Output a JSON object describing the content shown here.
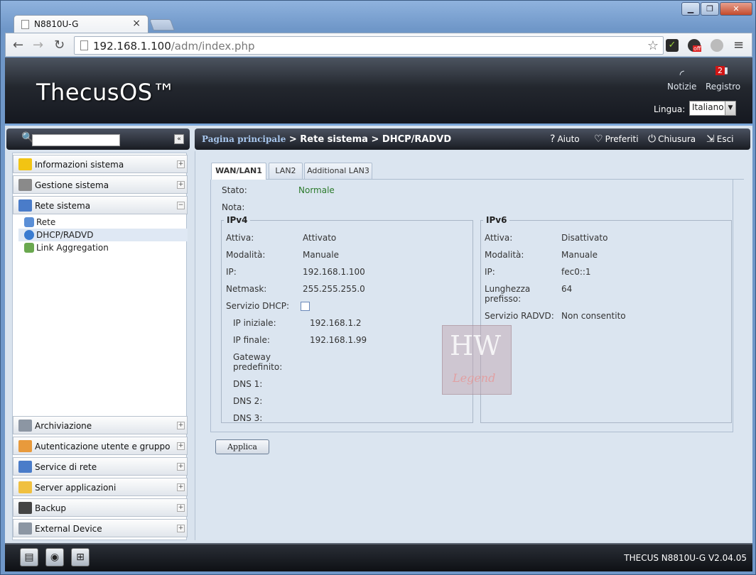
{
  "browser": {
    "tab_title": "N8810U-G",
    "tab_close": "×",
    "url_host": "192.168.1.100",
    "url_path": "/adm/index.php",
    "minimize": "▁",
    "maximize": "❐",
    "close": "✕"
  },
  "header": {
    "logo": "ThecusOS™",
    "news_label": "Notizie",
    "log_label": "Registro",
    "log_badge": "2",
    "lang_label": "Lingua:",
    "lang_value": "Italiano"
  },
  "sidebar": {
    "groups_top": [
      {
        "label": "Informazioni sistema",
        "toggle": "+",
        "icon_color": "#f2c413"
      },
      {
        "label": "Gestione sistema",
        "toggle": "+",
        "icon_color": "#777"
      },
      {
        "label": "Rete sistema",
        "toggle": "−",
        "icon_color": "#4a7cc9"
      }
    ],
    "subitems": [
      {
        "label": "Rete"
      },
      {
        "label": "DHCP/RADVD"
      },
      {
        "label": "Link Aggregation"
      }
    ],
    "groups_bottom": [
      {
        "label": "Archiviazione",
        "toggle": "+"
      },
      {
        "label": "Autenticazione utente e gruppo",
        "toggle": "+"
      },
      {
        "label": "Service di rete",
        "toggle": "+"
      },
      {
        "label": "Server applicazioni",
        "toggle": "+"
      },
      {
        "label": "Backup",
        "toggle": "+"
      },
      {
        "label": "External Device",
        "toggle": "+"
      }
    ]
  },
  "breadcrumb": {
    "home": "Pagina principale",
    "sep1": " > ",
    "section": "Rete sistema",
    "sep2": " > ",
    "page": "DHCP/RADVD"
  },
  "actions": {
    "help": "Aiuto",
    "favorites": "Preferiti",
    "shutdown": "Chiusura",
    "logout": "Esci"
  },
  "tabs": [
    "WAN/LAN1",
    "LAN2",
    "Additional LAN3"
  ],
  "form": {
    "status_label": "Stato:",
    "status_value": "Normale",
    "note_label": "Nota:",
    "ipv4": {
      "legend": "IPv4",
      "active_label": "Attiva:",
      "active_value": "Attivato",
      "mode_label": "Modalità:",
      "mode_value": "Manuale",
      "ip_label": "IP:",
      "ip_value": "192.168.1.100",
      "netmask_label": "Netmask:",
      "netmask_value": "255.255.255.0",
      "dhcp_label": "Servizio DHCP:",
      "start_label": "IP iniziale:",
      "start_value": "192.168.1.2",
      "end_label": "IP finale:",
      "end_value": "192.168.1.99",
      "gateway_label_1": "Gateway",
      "gateway_label_2": "predefinito:",
      "dns1_label": "DNS 1:",
      "dns2_label": "DNS 2:",
      "dns3_label": "DNS 3:"
    },
    "ipv6": {
      "legend": "IPv6",
      "active_label": "Attiva:",
      "active_value": "Disattivato",
      "mode_label": "Modalità:",
      "mode_value": "Manuale",
      "ip_label": "IP:",
      "ip_value": "fec0::1",
      "prefix_label_1": "Lunghezza",
      "prefix_label_2": "prefisso:",
      "prefix_value": "64",
      "radvd_label": "Servizio RADVD:",
      "radvd_value": "Non consentito"
    },
    "apply": "Applica"
  },
  "watermark": {
    "line1": "HW",
    "line2": "Legend"
  },
  "footer": {
    "version": "THECUS N8810U-G V2.04.05"
  }
}
